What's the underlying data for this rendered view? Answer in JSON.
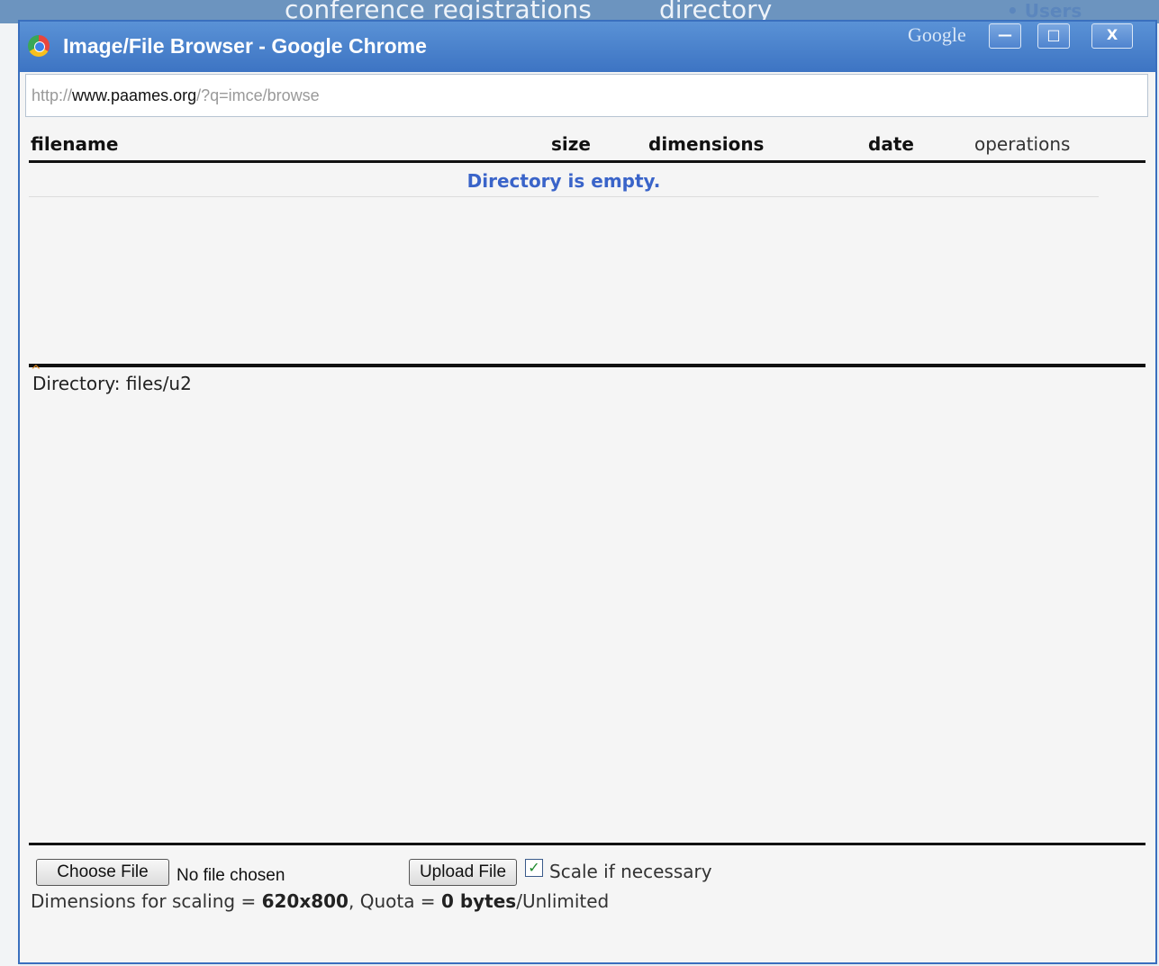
{
  "background": {
    "tab1": "conference registrations",
    "tab2": "directory",
    "users": "• Users"
  },
  "window": {
    "title": "Image/File Browser - Google Chrome",
    "google_label": "Google",
    "controls": {
      "minimize": "—",
      "maximize": "□",
      "close": "X"
    }
  },
  "address": {
    "prefix": "http://",
    "host": "www.paames.org",
    "path": "/?q=imce/browse"
  },
  "table": {
    "headers": {
      "filename": "filename",
      "size": "size",
      "dimensions": "dimensions",
      "date": "date",
      "operations": "operations"
    },
    "empty_message": "Directory is empty."
  },
  "directory": {
    "label": "Directory: files/u2"
  },
  "upload": {
    "choose_label": "Choose File",
    "no_file": "No file chosen",
    "upload_label": "Upload File",
    "scale_checked": true,
    "scale_label": "Scale if necessary",
    "info_prefix": "Dimensions for scaling = ",
    "dimensions": "620x800",
    "info_mid": ", Quota = ",
    "quota": "0 bytes",
    "info_suffix": "/Unlimited"
  }
}
